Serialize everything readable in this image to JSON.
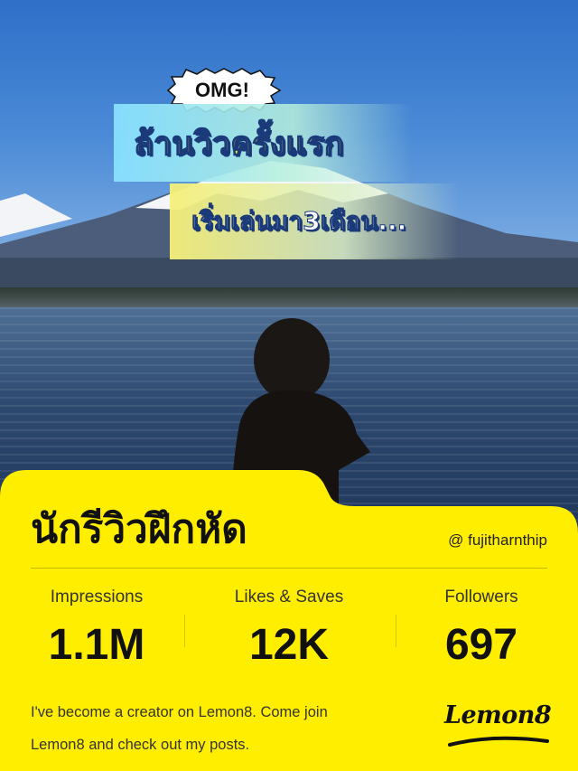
{
  "overlay": {
    "badge_text": "OMG!",
    "headline_1": "ล้านวิวครั้งแรก",
    "headline_2": "เริ่มเล่นมา3เดือน..."
  },
  "profile": {
    "name": "นักรีวิวฝึกหัด",
    "handle": "@ fujitharnthip"
  },
  "stats": [
    {
      "label": "Impressions",
      "value": "1.1M"
    },
    {
      "label": "Likes & Saves",
      "value": "12K"
    },
    {
      "label": "Followers",
      "value": "697"
    }
  ],
  "footer": {
    "line_1": "I've become a creator on Lemon8. Come join",
    "line_2": "Lemon8 and check out my posts."
  },
  "brand": {
    "logo_text": "Lemon8"
  },
  "colors": {
    "card_yellow": "#ffee00",
    "text_dark": "#111111",
    "sky_blue": "#3a7bd0"
  },
  "icons": {
    "badge_shape": "starburst-badge",
    "logo": "lemon8-logo"
  }
}
